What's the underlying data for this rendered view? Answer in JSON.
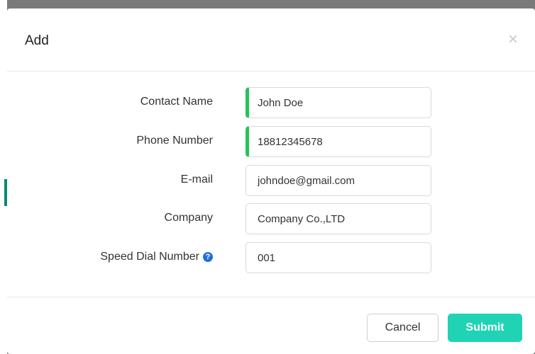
{
  "dialog": {
    "title": "Add",
    "close_icon": "close-icon"
  },
  "form": {
    "fields": [
      {
        "label": "Contact Name",
        "value": "John Doe",
        "required": true
      },
      {
        "label": "Phone Number",
        "value": "18812345678",
        "required": true
      },
      {
        "label": "E-mail",
        "value": "johndoe@gmail.com",
        "required": false
      },
      {
        "label": "Company",
        "value": "Company Co.,LTD",
        "required": false
      },
      {
        "label": "Speed Dial Number",
        "value": "001",
        "required": false,
        "help_icon": "question-circle-icon"
      }
    ]
  },
  "footer": {
    "cancel_label": "Cancel",
    "submit_label": "Submit"
  },
  "colors": {
    "required_marker": "#27c25a",
    "submit_button": "#1fd3b4",
    "help_icon": "#1f6fe0"
  }
}
